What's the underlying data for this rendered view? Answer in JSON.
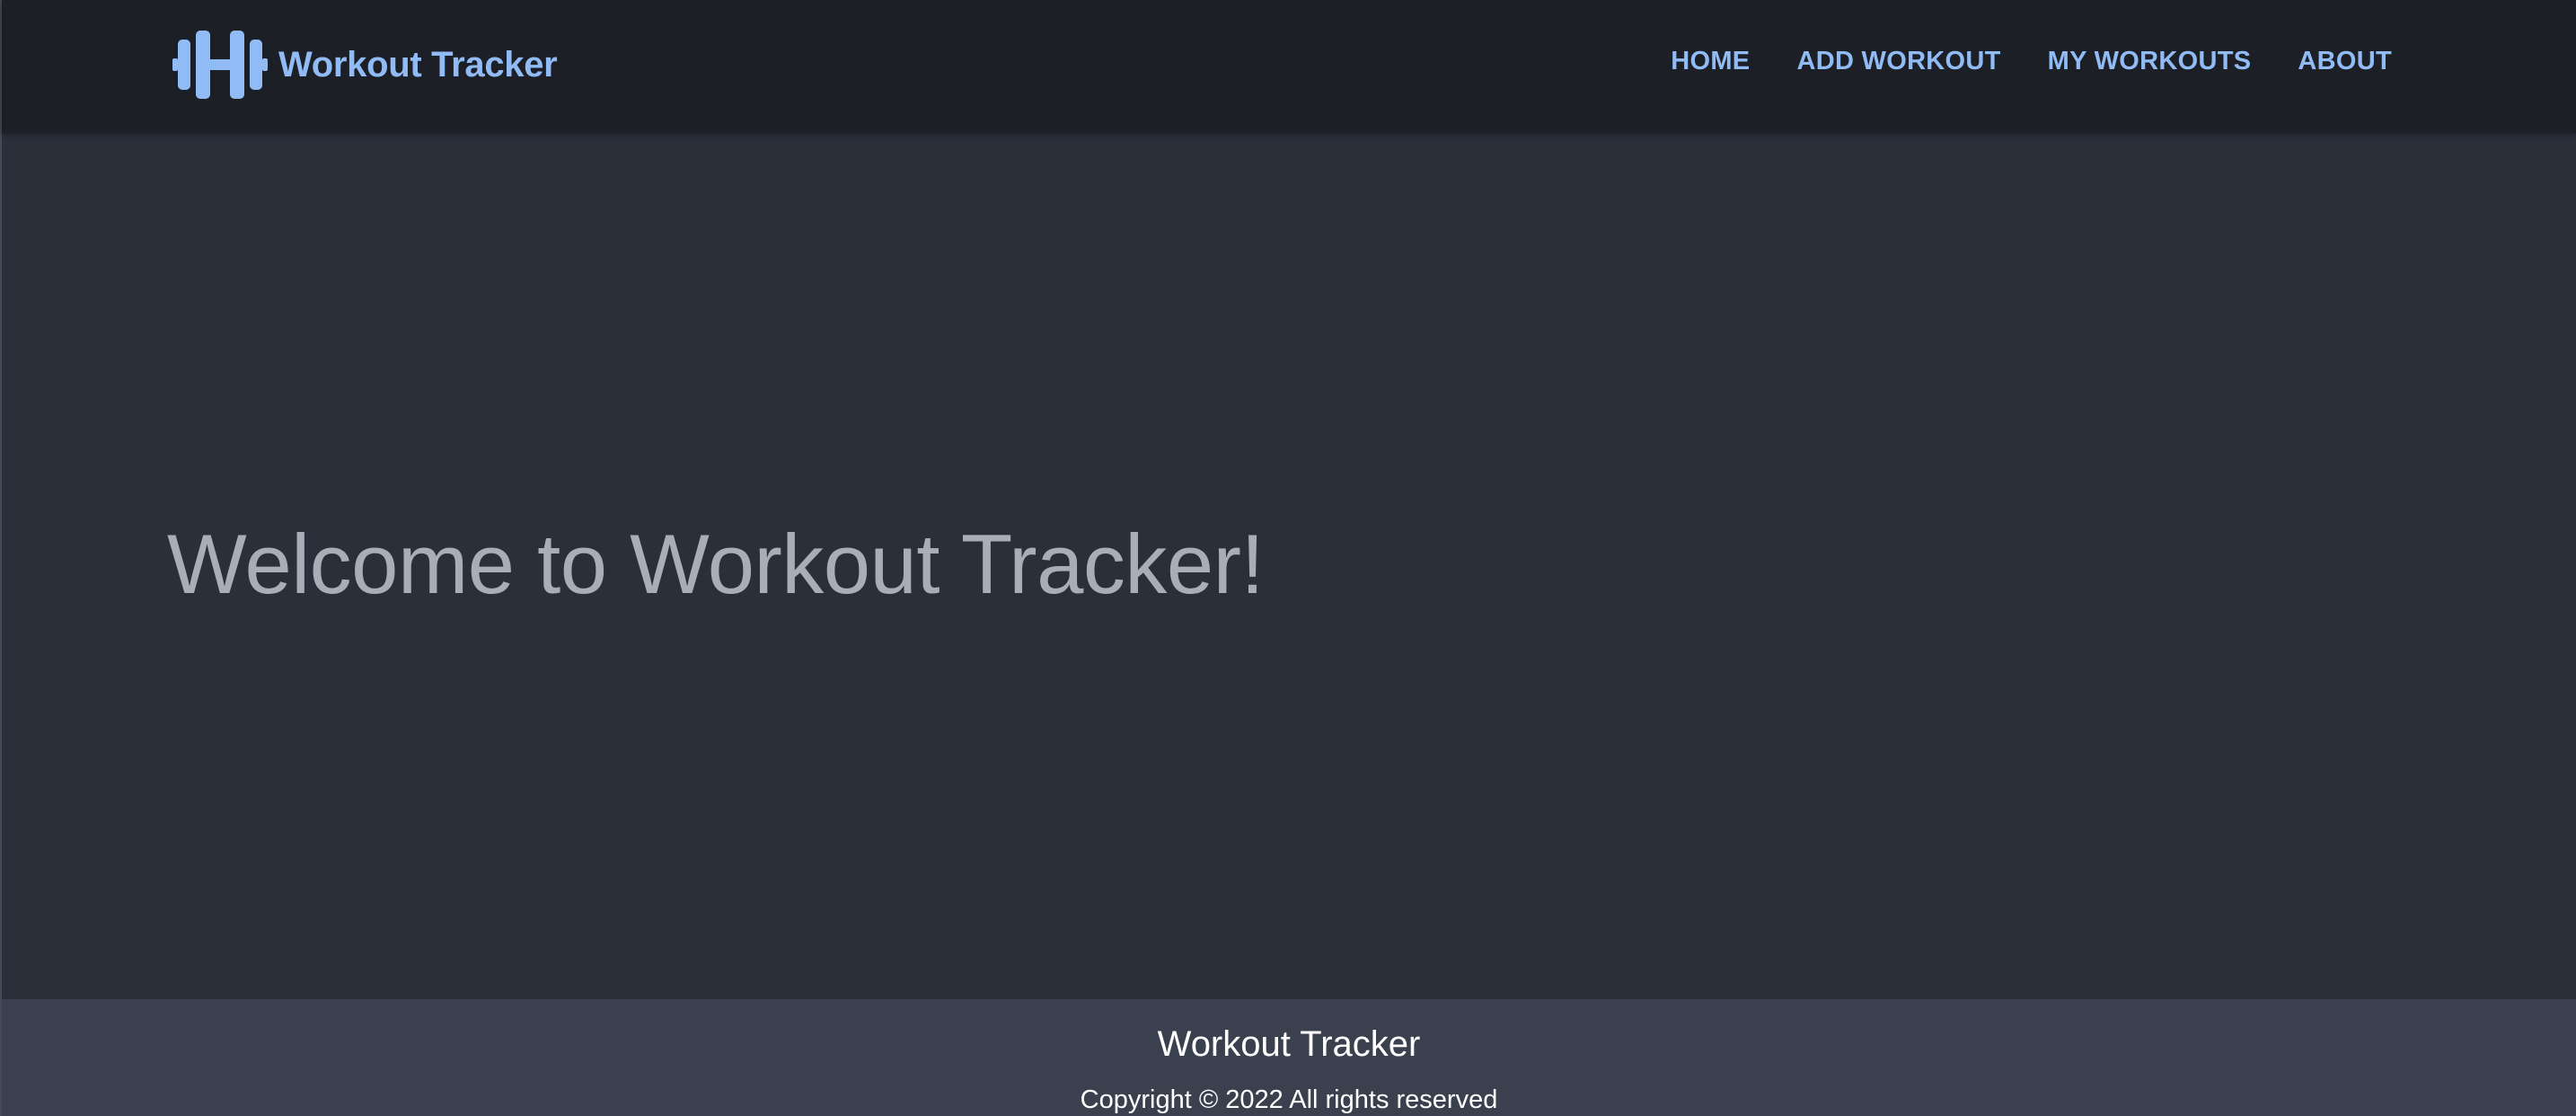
{
  "navbar": {
    "brand": {
      "icon": "dumbbell-icon",
      "title": "Workout Tracker"
    },
    "links": [
      {
        "label": "HOME"
      },
      {
        "label": "ADD WORKOUT"
      },
      {
        "label": "MY WORKOUTS"
      },
      {
        "label": "ABOUT"
      }
    ]
  },
  "hero": {
    "title": "Welcome to Workout Tracker!"
  },
  "footer": {
    "title": "Workout Tracker",
    "copyright": "Copyright © 2022 All rights reserved"
  },
  "colors": {
    "navbar_bg": "#1c1f26",
    "accent": "#91bbf5",
    "hero_bg": "#2b2f3a",
    "hero_text": "#a9adb8",
    "footer_bg": "#3b404f",
    "footer_text": "#ffffff"
  }
}
